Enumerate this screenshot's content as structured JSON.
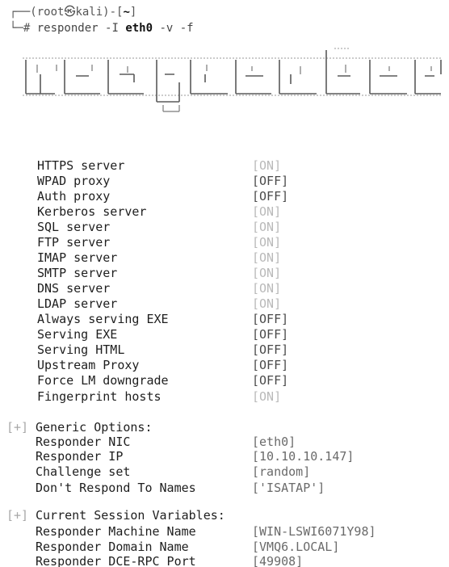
{
  "prompt": {
    "line1_prefix": "┌──(",
    "user": "root",
    "at": "㉿",
    "host": "kali",
    "sep": ")-[",
    "dir": "~",
    "line1_suffix": "]",
    "line2_prefix": "└─# ",
    "cmd_name": "responder",
    "cmd_flag1": "-I",
    "cmd_iface": "eth0",
    "cmd_rest": "-v -f"
  },
  "servers": [
    {
      "label": "HTTPS server",
      "value": "[ON]",
      "state": "on"
    },
    {
      "label": "WPAD proxy",
      "value": "[OFF]",
      "state": "off"
    },
    {
      "label": "Auth proxy",
      "value": "[OFF]",
      "state": "off"
    },
    {
      "label": "Kerberos server",
      "value": "[ON]",
      "state": "on"
    },
    {
      "label": "SQL server",
      "value": "[ON]",
      "state": "on"
    },
    {
      "label": "FTP server",
      "value": "[ON]",
      "state": "on"
    },
    {
      "label": "IMAP server",
      "value": "[ON]",
      "state": "on"
    },
    {
      "label": "SMTP server",
      "value": "[ON]",
      "state": "on"
    },
    {
      "label": "DNS server",
      "value": "[ON]",
      "state": "on"
    },
    {
      "label": "LDAP server",
      "value": "[ON]",
      "state": "on"
    },
    {
      "label": "Always serving EXE",
      "value": "[OFF]",
      "state": "off"
    },
    {
      "label": "Serving EXE",
      "value": "[OFF]",
      "state": "off"
    },
    {
      "label": "Serving HTML",
      "value": "[OFF]",
      "state": "off"
    },
    {
      "label": "Upstream Proxy",
      "value": "[OFF]",
      "state": "off"
    },
    {
      "label": "Force LM downgrade",
      "value": "[OFF]",
      "state": "off"
    },
    {
      "label": "Fingerprint hosts",
      "value": "[ON]",
      "state": "on"
    }
  ],
  "generic": {
    "plus": "[+]",
    "title": "Generic Options:",
    "items": [
      {
        "label": "Responder NIC",
        "value": "[eth0]"
      },
      {
        "label": "Responder IP",
        "value": "[10.10.10.147]"
      },
      {
        "label": "Challenge set",
        "value": "[random]"
      },
      {
        "label": "Don't Respond To Names",
        "value": "['ISATAP']"
      }
    ]
  },
  "session": {
    "plus": "[+]",
    "title": "Current Session Variables:",
    "items": [
      {
        "label": "Responder Machine Name",
        "value": "[WIN-LSWI6071Y98]"
      },
      {
        "label": "Responder Domain Name",
        "value": "[VMQ6.LOCAL]"
      },
      {
        "label": "Responder DCE-RPC Port",
        "value": "[49908]"
      }
    ]
  },
  "colors": {
    "on": "#b9b9b9",
    "off": "#4a4a4a",
    "plus": "#a8a8a8"
  }
}
